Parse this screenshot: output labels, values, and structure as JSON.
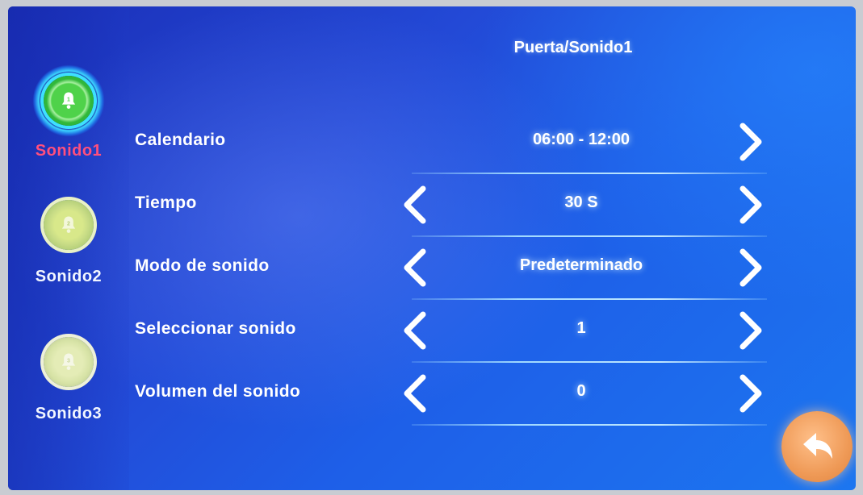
{
  "header": {
    "title": "Puerta/Sonido1"
  },
  "sidebar": {
    "items": [
      {
        "label": "Sonido1",
        "badge": "1",
        "selected": true,
        "icon": "bell-icon"
      },
      {
        "label": "Sonido2",
        "badge": "2",
        "selected": false,
        "icon": "bell-icon"
      },
      {
        "label": "Sonido3",
        "badge": "3",
        "selected": false,
        "icon": "bell-icon"
      }
    ]
  },
  "settings": {
    "rows": [
      {
        "label": "Calendario",
        "value": "06:00 - 12:00",
        "has_prev": false,
        "has_next": true
      },
      {
        "label": "Tiempo",
        "value": "30 S",
        "has_prev": true,
        "has_next": true
      },
      {
        "label": "Modo de sonido",
        "value": "Predeterminado",
        "has_prev": true,
        "has_next": true
      },
      {
        "label": "Seleccionar sonido",
        "value": "1",
        "has_prev": true,
        "has_next": true
      },
      {
        "label": "Volumen del sonido",
        "value": "0",
        "has_prev": true,
        "has_next": true
      }
    ]
  },
  "colors": {
    "background": "#2349d6",
    "selected_label": "#ff4f7d",
    "selected_icon": "#4fd24a",
    "back_button": "#ef9a57",
    "text": "#ffffff"
  },
  "icons": {
    "prev": "chevron-left-icon",
    "next": "chevron-right-icon",
    "back": "back-arrow-icon"
  }
}
